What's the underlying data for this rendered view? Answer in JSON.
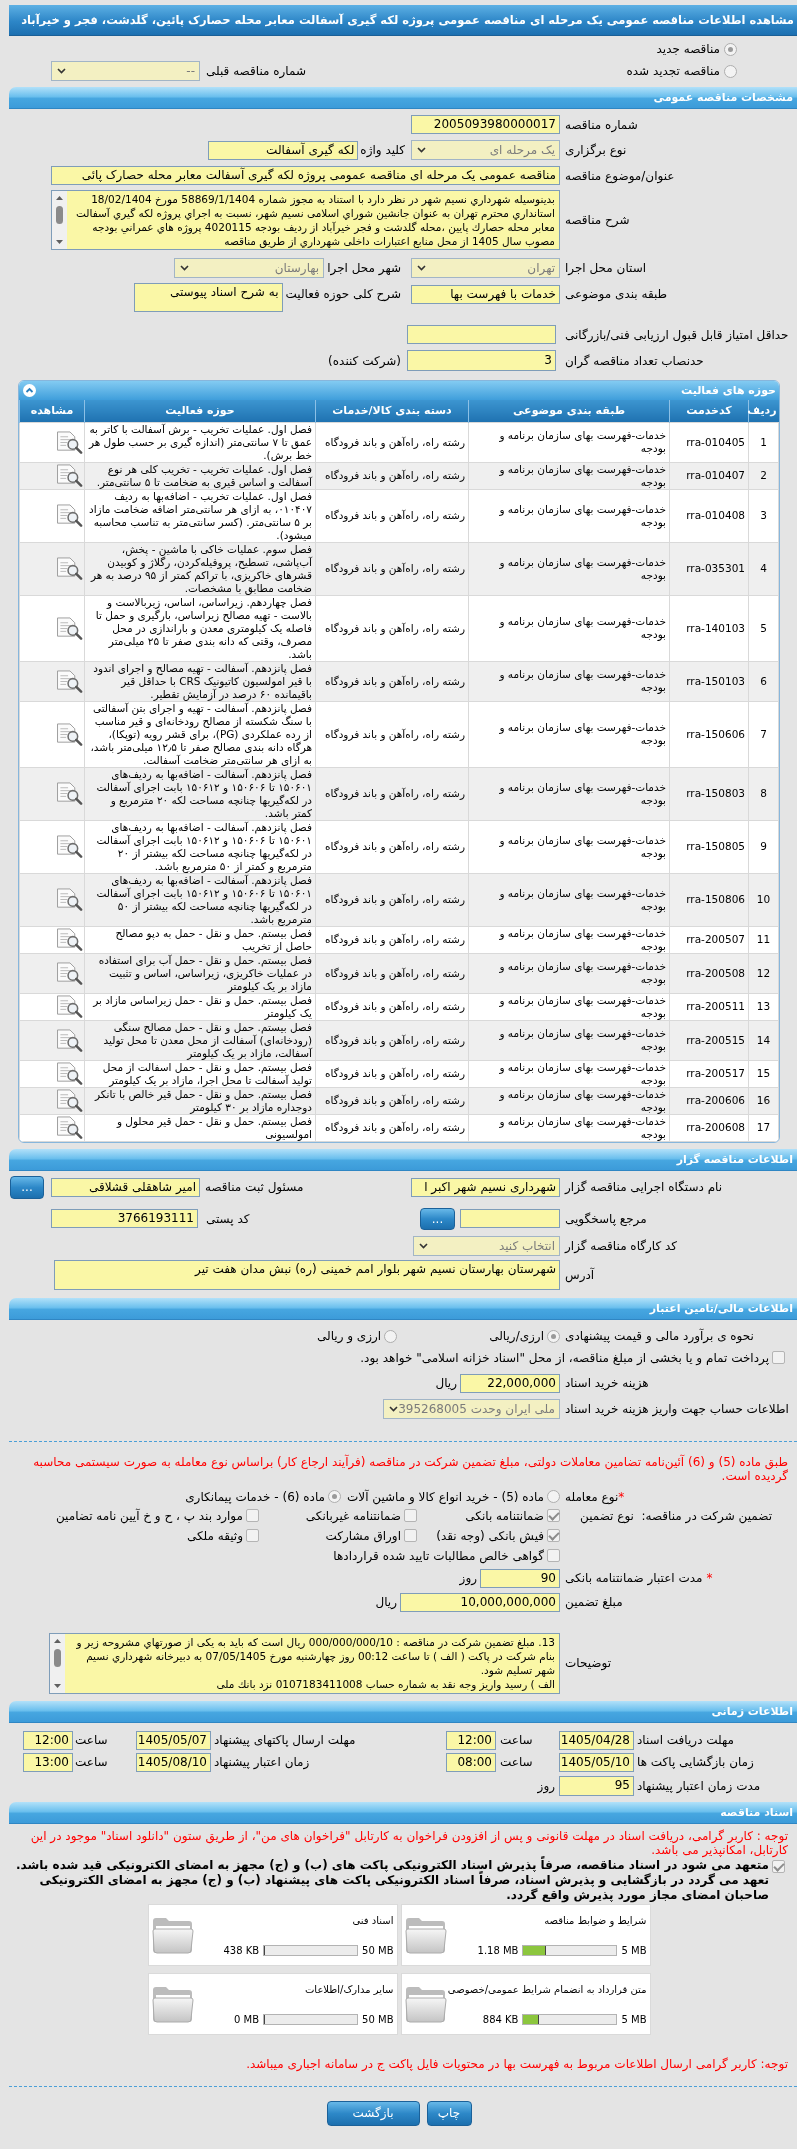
{
  "title": "مشاهده اطلاعات مناقصه عمومی یک مرحله ای مناقصه عمومی پروژه لکه گیری آسفالت معابر محله حصارک پائین، گلدشت، فجر و خیرآباد",
  "tender_status": [
    {
      "label": "مناقصه جدید",
      "selected": true
    },
    {
      "label": "مناقصه تجدید شده",
      "selected": false
    }
  ],
  "previous_tender": {
    "label": "شماره مناقصه قبلی",
    "value": "--"
  },
  "general": {
    "heading": "مشخصات مناقصه عمومی",
    "tender_number": {
      "label": "شماره مناقصه",
      "value": "2005093980000017"
    },
    "holding_type": {
      "label": "نوع برگزاری",
      "value": "یک مرحله ای"
    },
    "keyword": {
      "label": "کلید واژه",
      "value": "لکه گیری آسفالت"
    },
    "subject": {
      "label": "عنوان/موضوع مناقصه",
      "value": "مناقصه عمومی یک مرحله ای مناقصه عمومی پروژه لکه گیری آسفالت معابر محله حصارک پائی"
    },
    "description": {
      "label": "شرح مناقصه",
      "value": "بدینوسیله شهرداري نسیم شهر در نظر دارد با استناد به مجوز شماره 58869/1/1404 مورخ 18/02/1404 استانداري محترم تهران به عنوان جانشین شوراي اسلامی نسیم شهر، نسبت به اجراي پروژه لکه گیري آسفالت معابر محله حصارك پایین ،محله گلدشت و فجر خیرآباد از ردیف بودجه 4020115 پروژه هاي عمراني بودجه مصوب سال 1405 از محل منابع اعتبارات داخلی شهرداري از طریق مناقصه"
    },
    "province": {
      "label": "استان محل اجرا",
      "value": "تهران"
    },
    "city": {
      "label": "شهر محل اجرا",
      "value": "بهارستان"
    },
    "category": {
      "label": "طبقه بندی موضوعی",
      "value": "خدمات با فهرست بها"
    },
    "activity_summary": {
      "label": "شرح کلی حوزه فعالیت",
      "value": "به شرح اسناد پیوستی"
    },
    "min_score": {
      "label": "حداقل امتیاز قابل قبول ارزیابی فنی/بازرگانی"
    },
    "min_bidders": {
      "label": "حدنصاب تعداد مناقصه گران",
      "value": "3",
      "unit": "(شرکت کننده)"
    }
  },
  "activities": {
    "heading": "حوزه های فعالیت",
    "expanded": true,
    "columns": [
      "ردیف",
      "کدخدمت",
      "طبقه بندی موضوعی",
      "دسته بندی کالا/خدمات",
      "حوزه فعالیت",
      "مشاهده"
    ],
    "rows": [
      {
        "number": "1",
        "code": "rra-010405",
        "classification": "خدمات-فهرست بهای سازمان برنامه و بودجه",
        "category": "رشته راه، راه‌آهن و باند فرودگاه",
        "activity": "فصل اول. عملیات تخریب - برش آسفالت با کاتر به عمق تا ۷ سانتی‌متر (اندازه گیری بر حسب طول هر خط برش)."
      },
      {
        "number": "2",
        "code": "rra-010407",
        "classification": "خدمات-فهرست بهای سازمان برنامه و بودجه",
        "category": "رشته راه، راه‌آهن و باند فرودگاه",
        "activity": "فصل اول. عملیات تخریب - تخریب کلی هر نوع آسفالت و اساس قیری به ضخامت تا ۵ سانتی‌متر."
      },
      {
        "number": "3",
        "code": "rra-010408",
        "classification": "خدمات-فهرست بهای سازمان برنامه و بودجه",
        "category": "رشته راه، راه‌آهن و باند فرودگاه",
        "activity": "فصل اول. عملیات تخریب - اضافه‌بها به ردیف ۰۱۰۴۰۷، به ازای هر سانتی‌متر اضافه ضخامت مازاد بر ۵ سانتی‌متر. (کسر سانتی‌متر به تناسب محاسبه میشود)."
      },
      {
        "number": "4",
        "code": "rra-035301",
        "classification": "خدمات-فهرست بهای سازمان برنامه و بودجه",
        "category": "رشته راه، راه‌آهن و باند فرودگاه",
        "activity": "فصل سوم. عملیات خاکی با ماشین - پخش، آب‌پاشی، تسطیح، پروفیله‌کردن، رگلاژ و کوبیدن قشرهای خاکریزی، با تراکم کمتر از ۹۵ درصد به هر ضخامت مطابق با مشخصات."
      },
      {
        "number": "5",
        "code": "rra-140103",
        "classification": "خدمات-فهرست بهای سازمان برنامه و بودجه",
        "category": "رشته راه، راه‌آهن و باند فرودگاه",
        "activity": "فصل چهاردهم. زیراساس، اساس، زیربالاست و بالاست - تهیه مصالح زیراساس، بارگیری و حمل تا فاصله یک کیلومتری معدن و باراندازی در محل مصرف، وقتی که دانه بندی صفر تا ۲۵ میلی‌متر باشد."
      },
      {
        "number": "6",
        "code": "rra-150103",
        "classification": "خدمات-فهرست بهای سازمان برنامه و بودجه",
        "category": "رشته راه، راه‌آهن و باند فرودگاه",
        "activity": "فصل پانزدهم. آسفالت - تهیه مصالح و اجرای اندود با قیر امولسیون کاتیونیک CRS با حداقل قیر باقیمانده ۶۰ درصد در آزمایش تقطیر."
      },
      {
        "number": "7",
        "code": "rra-150606",
        "classification": "خدمات-فهرست بهای سازمان برنامه و بودجه",
        "category": "رشته راه، راه‌آهن و باند فرودگاه",
        "activity": "فصل پانزدهم. آسفالت - تهیه و اجرای بتن آسفالتی با سنگ شکسته از مصالح رودخانه‌ای و قیر مناسب از رده عملکردی (PG)، برای قشر رویه (توپکا)، هرگاه دانه بندی مصالح صفر تا ۱۲٫۵ میلی‌متر باشد، به ازای هر سانتی‌متر ضخامت آسفالت."
      },
      {
        "number": "8",
        "code": "rra-150803",
        "classification": "خدمات-فهرست بهای سازمان برنامه و بودجه",
        "category": "رشته راه، راه‌آهن و باند فرودگاه",
        "activity": "فصل پانزدهم. آسفالت - اضافه‌بها به ردیف‌های ۱۵۰۶۰۱ تا ۱۵۰۶۰۶ و ۱۵۰۶۱۲ بابت اجرای آسفالت در لکه‌گیریها چنانچه مساحت لکه ۲۰ مترمربع و کمتر باشد."
      },
      {
        "number": "9",
        "code": "rra-150805",
        "classification": "خدمات-فهرست بهای سازمان برنامه و بودجه",
        "category": "رشته راه، راه‌آهن و باند فرودگاه",
        "activity": "فصل پانزدهم. آسفالت - اضافه‌بها به ردیف‌های ۱۵۰۶۰۱ تا ۱۵۰۶۰۶ و ۱۵۰۶۱۲ بابت اجرای آسفالت در لکه‌گیریها چنانچه مساحت لکه بیشتر از ۲۰ مترمربع و کمتر از ۵۰ مترمربع باشد."
      },
      {
        "number": "10",
        "code": "rra-150806",
        "classification": "خدمات-فهرست بهای سازمان برنامه و بودجه",
        "category": "رشته راه، راه‌آهن و باند فرودگاه",
        "activity": "فصل پانزدهم. آسفالت - اضافه‌بها به ردیف‌های ۱۵۰۶۰۱ تا ۱۵۰۶۰۶ و ۱۵۰۶۱۲ بابت اجرای آسفالت در لکه‌گیریها چنانچه مساحت لکه بیشتر از ۵۰ مترمربع باشد."
      },
      {
        "number": "11",
        "code": "rra-200507",
        "classification": "خدمات-فهرست بهای سازمان برنامه و بودجه",
        "category": "رشته راه، راه‌آهن و باند فرودگاه",
        "activity": "فصل بیستم. حمل و نقل - حمل به دپو مصالح حاصل از تخریب"
      },
      {
        "number": "12",
        "code": "rra-200508",
        "classification": "خدمات-فهرست بهای سازمان برنامه و بودجه",
        "category": "رشته راه، راه‌آهن و باند فرودگاه",
        "activity": "فصل بیستم. حمل و نقل - حمل آب برای استفاده در عملیات خاکریزی، زیراساس، اساس و تثبیت مازاد بر یک کیلومتر"
      },
      {
        "number": "13",
        "code": "rra-200511",
        "classification": "خدمات-فهرست بهای سازمان برنامه و بودجه",
        "category": "رشته راه، راه‌آهن و باند فرودگاه",
        "activity": "فصل بیستم. حمل و نقل - حمل زیراساس مازاد بر یک کیلومتر"
      },
      {
        "number": "14",
        "code": "rra-200515",
        "classification": "خدمات-فهرست بهای سازمان برنامه و بودجه",
        "category": "رشته راه، راه‌آهن و باند فرودگاه",
        "activity": "فصل بیستم. حمل و نقل - حمل مصالح سنگی (رودخانه‌ای) آسفالت از محل معدن تا محل تولید آسفالت، مازاد بر یک کیلومتر"
      },
      {
        "number": "15",
        "code": "rra-200517",
        "classification": "خدمات-فهرست بهای سازمان برنامه و بودجه",
        "category": "رشته راه، راه‌آهن و باند فرودگاه",
        "activity": "فصل بیستم. حمل و نقل - حمل اسفالت از محل تولید آسفالت تا محل اجرا، مازاد بر یک کیلومتر"
      },
      {
        "number": "16",
        "code": "rra-200606",
        "classification": "خدمات-فهرست بهای سازمان برنامه و بودجه",
        "category": "رشته راه، راه‌آهن و باند فرودگاه",
        "activity": "فصل بیستم. حمل و نقل - حمل قیر خالص با تانکر دوجداره مازاد بر ۳۰ کیلومتر"
      },
      {
        "number": "17",
        "code": "rra-200608",
        "classification": "خدمات-فهرست بهای سازمان برنامه و بودجه",
        "category": "رشته راه، راه‌آهن و باند فرودگاه",
        "activity": "فصل بیستم. حمل و نقل - حمل قیر محلول و امولسیونی"
      }
    ]
  },
  "tenderer": {
    "heading": "اطلاعات مناقصه گزار",
    "agency": {
      "label": "نام دستگاه اجرایی مناقصه گزار",
      "value": "شهرداری نسیم شهر اکبر ا"
    },
    "registrar": {
      "label": "مسئول ثبت مناقصه",
      "value": "امیر شاهقلی قشلاقی",
      "button": "..."
    },
    "responder": {
      "label": "مرجع پاسخگویی",
      "button": "..."
    },
    "postal_code": {
      "label": "کد پستی",
      "value": "3766193111"
    },
    "workshop": {
      "label": "کد کارگاه مناقصه گزار",
      "value": "انتخاب کنید"
    },
    "address": {
      "label": "آدرس",
      "value": "شهرستان بهارستان نسیم شهر بلوار امم خمینی (ره) نبش مدان هفت تیر"
    }
  },
  "finance": {
    "heading": "اطلاعات مالی/تامین اعتبار",
    "estimate": {
      "label": "نحوه ی برآورد مالی و قیمت پیشنهادی",
      "options": [
        {
          "label": "ارزی/ریالی",
          "selected": true
        },
        {
          "label": "ارزی و ریالی",
          "selected": false
        }
      ]
    },
    "treasury": {
      "label": "پرداخت تمام و یا بخشی از مبلغ مناقصه، از محل \"اسناد خزانه اسلامی\" خواهد بود.",
      "checked": false
    },
    "document_fee": {
      "label": "هزینه خرید اسناد",
      "value": "22,000,000",
      "unit": "ریال"
    },
    "account": {
      "label": "اطلاعات حساب جهت واریز هزینه خرید اسناد",
      "value": "ملی ایران وحدت 395268005"
    }
  },
  "guarantee": {
    "note": "طبق ماده (5) و (6) آئین‌نامه تضامین معاملات دولتی، مبلغ تضمین شرکت در مناقصه (فرآیند ارجاع کار) براساس نوع معامله به صورت سیستمی محاسبه گردیده است.",
    "deal_type": {
      "required_mark": "*",
      "label": "نوع معامله",
      "options": [
        {
          "label": "ماده (5) - خرید انواع کالا و ماشین آلات",
          "selected": false
        },
        {
          "label": "ماده (6) - خدمات پیمانکاری",
          "selected": true
        }
      ]
    },
    "label": "تضمین شرکت در مناقصه:",
    "type_label": "نوع تضمین",
    "types": [
      {
        "label": "ضمانتنامه بانکی",
        "checked": true
      },
      {
        "label": "ضمانتنامه غیربانکی",
        "checked": false
      },
      {
        "label": "موارد بند پ ، ح و خ آیین نامه تضامین",
        "checked": false
      },
      {
        "label": "فیش بانکی (وجه نقد)",
        "checked": true
      },
      {
        "label": "اوراق مشارکت",
        "checked": false
      },
      {
        "label": "وثیقه ملکی",
        "checked": false
      },
      {
        "label": "گواهی خالص مطالبات تایید شده قراردادها",
        "checked": false
      }
    ],
    "validity": {
      "required_mark": "*",
      "label": "مدت اعتبار ضمانتنامه بانکی",
      "value": "90",
      "unit": "روز"
    },
    "amount": {
      "label": "مبلغ تضمین",
      "value": "10,000,000,000",
      "unit": "ریال"
    },
    "remarks": {
      "label": "توضیحات",
      "value": "13.   مبلغ تضمین شرکت در مناقصه : 000/000/000/10 ریال  است که باید به یکی از صورتهاي مشروحه زیر و بنام شرکت در پاکت ( الف ) تا ساعت 00:12 روز چهارشنبه مورخ 07/05/1405 به دبیرخانه شهرداري نسیم شهر تسلیم شود.\nالف ) رسید واریز وجه نقد به شماره حساب   0107183411008  نزد بانك ملی"
    }
  },
  "timing": {
    "heading": "اطلاعات زمانی",
    "items": [
      {
        "label": "مهلت دریافت اسناد",
        "date": "1405/04/28",
        "time_label": "ساعت",
        "time": "12:00"
      },
      {
        "label": "مهلت ارسال پاکتهای پیشنهاد",
        "date": "1405/05/07",
        "time_label": "ساعت",
        "time": "12:00"
      },
      {
        "label": "زمان بازگشایی پاکت ها",
        "date": "1405/05/10",
        "time_label": "ساعت",
        "time": "08:00"
      },
      {
        "label": "زمان اعتبار پیشنهاد",
        "date": "1405/08/10",
        "time_label": "ساعت",
        "time": "13:00"
      }
    ],
    "duration": {
      "label": "مدت زمان اعتبار پیشنهاد",
      "value": "95",
      "unit": "روز"
    }
  },
  "documents": {
    "heading": "اسناد مناقصه",
    "notice": "توجه : کاربر گرامی، دریافت اسناد در مهلت قانونی و پس از افزودن فراخوان به کارتابل \"فراخوان های من\"، از طریق ستون \"دانلود اسناد\" موجود در این کارتابل، امکانپذیر می باشد.",
    "commitment": {
      "text": "متعهد می شود در اسناد مناقصه، صرفاً پذیرش اسناد الکترونیکی پاکت های (ب) و (ج) مجهز به امضای الکترونیکی قید شده باشد. تعهد می گردد در بازگشایی و پذیرش اسناد، صرفاً اسناد الکترونیکی پاکت های پیشنهاد (ب) و (ج) مجهز به امضای الکترونیکی صاحبان امضای مجاز مورد پذیرش واقع گردد.",
      "checked": true
    },
    "files": [
      {
        "title": "شرایط و ضوابط مناقصه",
        "max": "5 MB",
        "size": "1.18 MB",
        "level": 0.24
      },
      {
        "title": "اسناد فنی",
        "max": "50 MB",
        "size": "438 KB",
        "level": 0.01
      },
      {
        "title": "متن قرارداد به انضمام شرایط عمومی/خصوصی",
        "max": "5 MB",
        "size": "884 KB",
        "level": 0.17
      },
      {
        "title": "سایر مدارک/اطلاعات",
        "max": "50 MB",
        "size": "0 MB",
        "level": 0
      }
    ],
    "footer_note": "توجه: کاربر گرامی ارسال اطلاعات مربوط به فهرست بها در محتویات فایل پاکت ج در سامانه اجباری میباشد."
  },
  "buttons": [
    "چاپ",
    "بازگشت"
  ]
}
